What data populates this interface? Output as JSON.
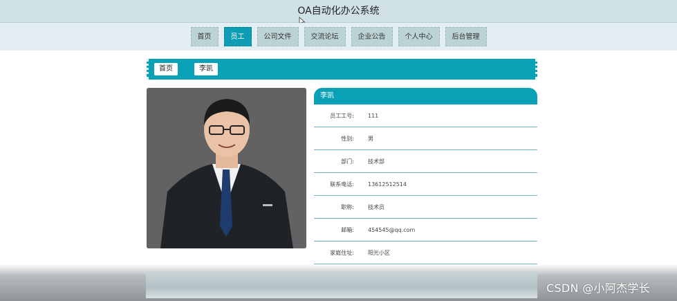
{
  "app": {
    "title": "OA自动化办公系统"
  },
  "nav": {
    "items": [
      "首页",
      "员工",
      "公司文件",
      "交流论坛",
      "企业公告",
      "个人中心",
      "后台管理"
    ],
    "active_index": 1
  },
  "breadcrumb": {
    "home": "首页",
    "current": "李凯"
  },
  "profile": {
    "name": "李凯",
    "fields": [
      {
        "label": "员工工号:",
        "value": "111"
      },
      {
        "label": "性别:",
        "value": "男"
      },
      {
        "label": "部门:",
        "value": "技术部"
      },
      {
        "label": "联系电话:",
        "value": "13612512514"
      },
      {
        "label": "职称:",
        "value": "技术员"
      },
      {
        "label": "邮箱:",
        "value": "454545@qq.com"
      },
      {
        "label": "家庭住址:",
        "value": "阳光小区"
      }
    ]
  },
  "watermark": "CSDN @小阿杰学长",
  "colors": {
    "accent": "#0aa1b7",
    "header_bg": "#cfe1e7",
    "nav_bg": "#e2eef2",
    "nav_item_bg": "#bcd3d6"
  }
}
